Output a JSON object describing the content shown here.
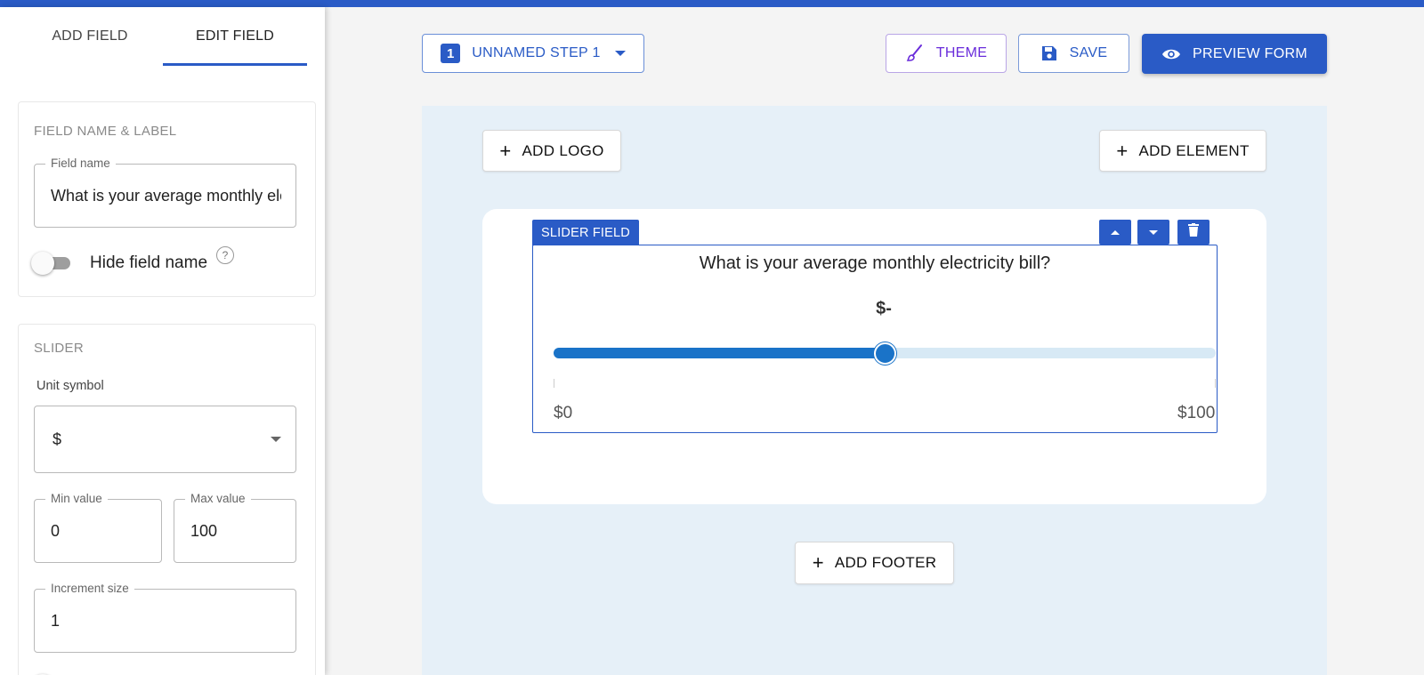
{
  "sidebar": {
    "tabs": [
      {
        "label": "ADD FIELD"
      },
      {
        "label": "EDIT FIELD"
      }
    ],
    "section1": {
      "title": "FIELD NAME & LABEL",
      "field_name_label": "Field name",
      "field_name_value": "What is your average monthly electricity bill?",
      "hide_toggle_label": "Hide field name",
      "hide_toggle_on": false,
      "help": "?"
    },
    "section2": {
      "title": "SLIDER",
      "unit_label": "Unit symbol",
      "unit_value": "$",
      "min_label": "Min value",
      "min_value": "0",
      "max_label": "Max value",
      "max_value": "100",
      "increment_label": "Increment size",
      "increment_value": "1"
    }
  },
  "toolbar": {
    "step_number": "1",
    "step_label": "UNNAMED STEP 1",
    "theme_label": "THEME",
    "save_label": "SAVE",
    "preview_label": "PREVIEW FORM"
  },
  "canvas": {
    "add_logo_label": "ADD LOGO",
    "add_element_label": "ADD ELEMENT",
    "add_footer_label": "ADD FOOTER",
    "field": {
      "tag": "SLIDER FIELD",
      "question": "What is your average monthly electricity bill?",
      "value_display": "$-",
      "min_display": "$0",
      "max_display": "$100",
      "slider_fraction": 0.5
    }
  },
  "colors": {
    "accent": "#2a5bc6",
    "slider": "#1a73c8",
    "theme": "#6a2ddb",
    "canvas_bg": "#e6f0f8"
  },
  "icons": {
    "step_dropdown": "caret-down-icon",
    "theme": "brush-icon",
    "save": "floppy-icon",
    "preview": "eye-icon",
    "move_up": "arrow-up-icon",
    "move_down": "arrow-down-icon",
    "delete": "trash-icon",
    "add": "plus-icon"
  }
}
